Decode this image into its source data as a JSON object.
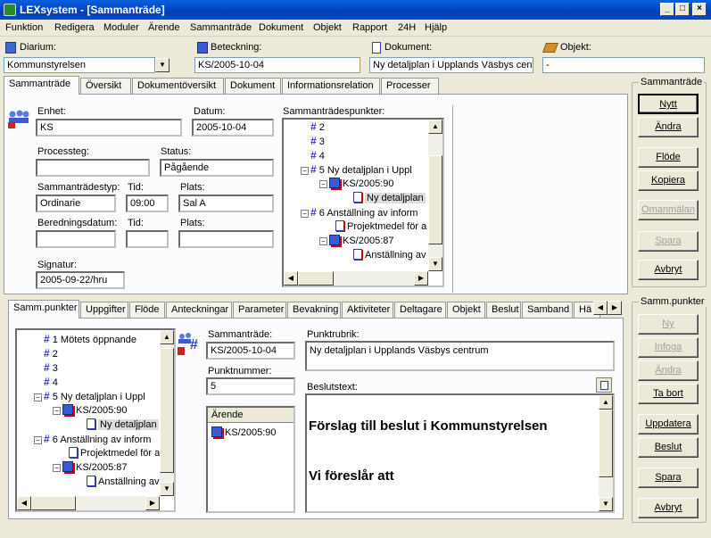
{
  "window": {
    "title": "LEXsystem - [Sammanträde]",
    "min": "_",
    "max": "□",
    "close": "×"
  },
  "menu": [
    "Funktion",
    "Redigera",
    "Moduler",
    "Ärende",
    "Sammanträde",
    "Dokument",
    "Objekt",
    "Rapport",
    "24H",
    "Hjälp"
  ],
  "header": {
    "diarium_label": "Diarium:",
    "diarium_value": "Kommunstyrelsen",
    "beteckning_label": "Beteckning:",
    "beteckning_value": "KS/2005-10-04",
    "dokument_label": "Dokument:",
    "dokument_value": "Ny detaljplan i Upplands Väsbys centr",
    "objekt_label": "Objekt:",
    "objekt_value": "-"
  },
  "top_tabs": [
    "Sammanträde",
    "Översikt",
    "Dokumentöversikt",
    "Dokument",
    "Informationsrelation",
    "Processer"
  ],
  "form": {
    "enhet_label": "Enhet:",
    "enhet_value": "KS",
    "datum_label": "Datum:",
    "datum_value": "2005-10-04",
    "processteg_label": "Processteg:",
    "processteg_value": "",
    "status_label": "Status:",
    "status_value": "Pågående",
    "typ_label": "Sammanträdestyp:",
    "typ_value": "Ordinarie",
    "tid_label": "Tid:",
    "tid_value": "09:00",
    "plats_label": "Plats:",
    "plats_value": "Sal A",
    "bered_label": "Beredningsdatum:",
    "bered_value": "",
    "tid2_label": "Tid:",
    "tid2_value": "",
    "plats2_label": "Plats:",
    "plats2_value": "",
    "signatur_label": "Signatur:",
    "signatur_value": "2005-09-22/hru",
    "punkter_label": "Sammanträdespunkter:"
  },
  "tree1": [
    "2",
    "3",
    "4",
    "5 Ny detaljplan i Uppl",
    "KS/2005:90",
    "Ny detaljplan",
    "6 Anställning av inform",
    "Projektmedel för a",
    "KS/2005:87",
    "Anställning av"
  ],
  "right1": {
    "title": "Sammanträde",
    "buttons": [
      "Nytt",
      "Ändra",
      "Flöde",
      "Kopiera",
      "Omanmälan",
      "Spara",
      "Avbryt"
    ]
  },
  "bottom_tabs": [
    "Samm.punkter",
    "Uppgifter",
    "Flöde",
    "Anteckningar",
    "Parameter",
    "Bevakning",
    "Aktiviteter",
    "Deltagare",
    "Objekt",
    "Beslut",
    "Samband",
    "Hä"
  ],
  "tree2": [
    "1 Mötets öppnande",
    "2",
    "3",
    "4",
    "5 Ny detaljplan i Uppl",
    "KS/2005:90",
    "Ny detaljplan",
    "6 Anställning av inform",
    "Projektmedel för a",
    "KS/2005:87",
    "Anställning av"
  ],
  "punkt": {
    "samm_label": "Sammanträde:",
    "samm_value": "KS/2005-10-04",
    "nr_label": "Punktnummer:",
    "nr_value": "5",
    "rubrik_label": "Punktrubrik:",
    "rubrik_value": "Ny detaljplan i Upplands Väsbys centrum",
    "beslut_label": "Beslutstext:",
    "beslut_line1": "Förslag till beslut i Kommunstyrelsen",
    "beslut_line2": "Vi föreslår att",
    "arende_header": "Ärende",
    "arende_item": "KS/2005:90"
  },
  "right2": {
    "title": "Samm.punkter",
    "buttons": [
      "Ny",
      "Infoga",
      "Ändra",
      "Ta bort",
      "Uppdatera",
      "Beslut",
      "Spara",
      "Avbryt"
    ]
  }
}
